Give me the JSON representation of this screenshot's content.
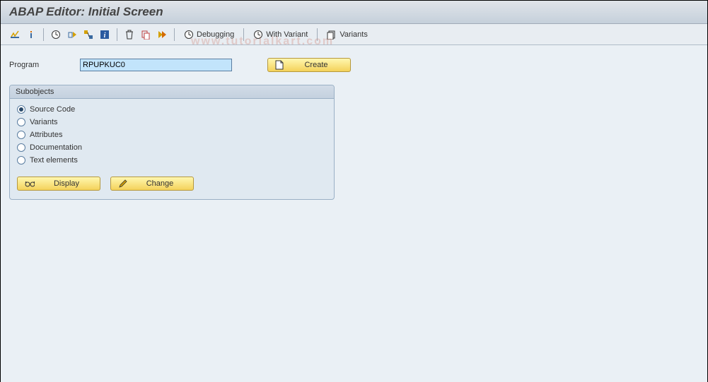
{
  "title": "ABAP Editor: Initial Screen",
  "toolbar": {
    "debugging": "Debugging",
    "with_variant": "With Variant",
    "variants": "Variants"
  },
  "program": {
    "label": "Program",
    "value": "RPUPKUC0"
  },
  "create_btn": "Create",
  "group": {
    "title": "Subobjects",
    "options": [
      {
        "label": "Source Code",
        "checked": true
      },
      {
        "label": "Variants",
        "checked": false
      },
      {
        "label": "Attributes",
        "checked": false
      },
      {
        "label": "Documentation",
        "checked": false
      },
      {
        "label": "Text elements",
        "checked": false
      }
    ]
  },
  "display_btn": "Display",
  "change_btn": "Change",
  "watermark": "www.tutorialkart.com"
}
